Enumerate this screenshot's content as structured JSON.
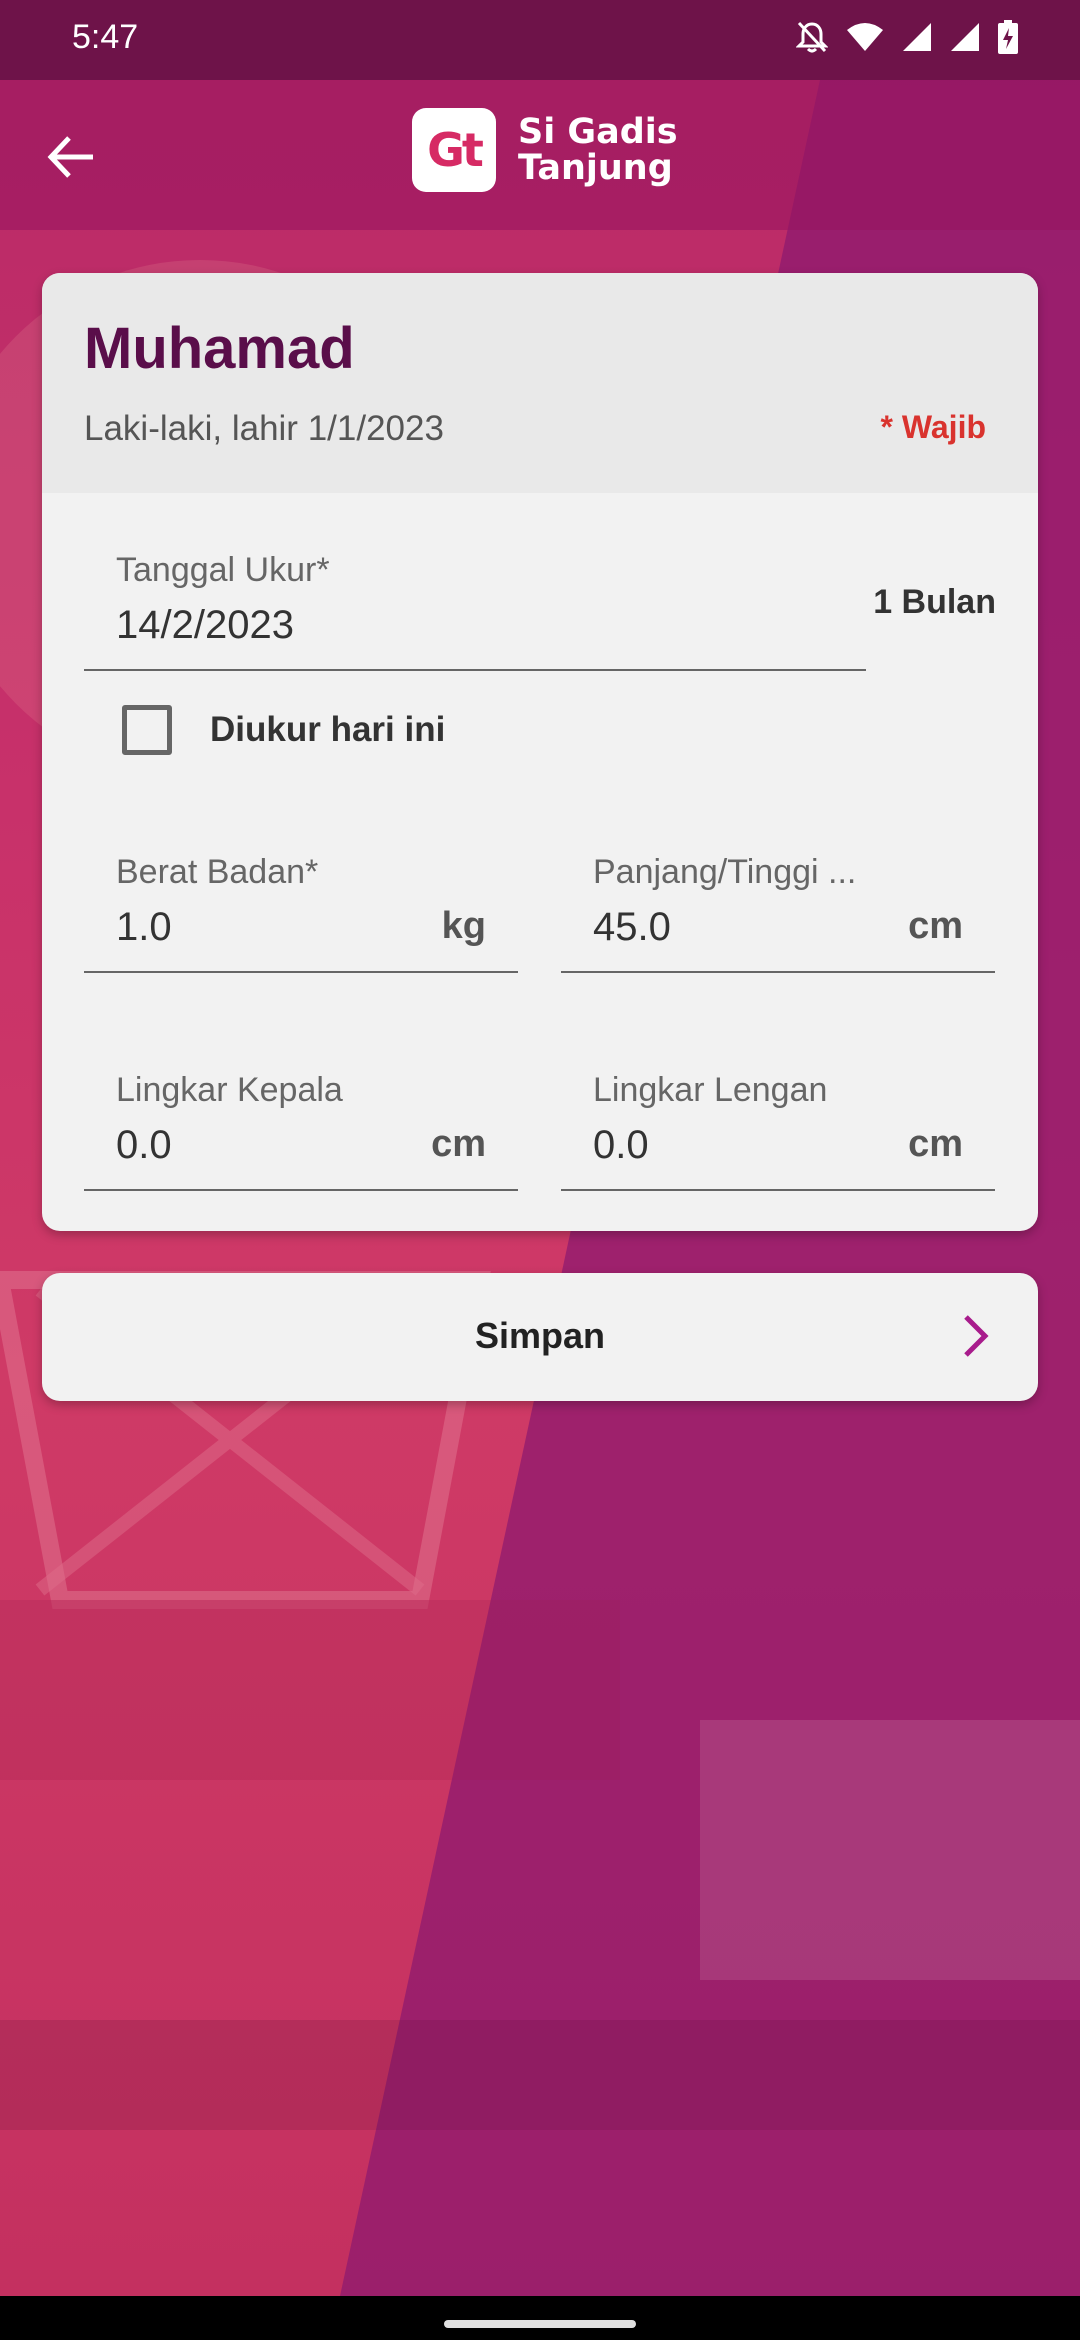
{
  "status_bar": {
    "time": "5:47",
    "icons": [
      "mute-icon",
      "wifi-icon",
      "signal-icon",
      "signal-icon",
      "battery-charging-icon"
    ]
  },
  "app_bar": {
    "logo_mark": "Gt",
    "logo_line1": "Si Gadis",
    "logo_line2": "Tanjung"
  },
  "child": {
    "name": "Muhamad",
    "subtitle": "Laki-laki, lahir 1/1/2023",
    "required_note": "* Wajib"
  },
  "form": {
    "measure_date": {
      "label": "Tanggal Ukur*",
      "value": "14/2/2023"
    },
    "age": "1 Bulan",
    "measured_today": {
      "label": "Diukur hari ini",
      "checked": false
    },
    "weight": {
      "label": "Berat Badan*",
      "value": "1.0",
      "unit": "kg"
    },
    "height": {
      "label": "Panjang/Tinggi ...",
      "value": "45.0",
      "unit": "cm"
    },
    "head_circ": {
      "label": "Lingkar Kepala",
      "value": "0.0",
      "unit": "cm"
    },
    "arm_circ": {
      "label": "Lingkar Lengan",
      "value": "0.0",
      "unit": "cm"
    }
  },
  "actions": {
    "save_label": "Simpan"
  },
  "colors": {
    "accent": "#5a0e4a",
    "required": "#d9332e",
    "chevron": "#a81c8c",
    "status_bar": "#6e1349"
  }
}
